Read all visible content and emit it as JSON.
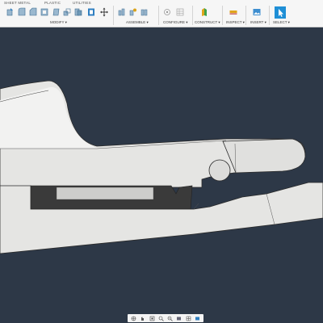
{
  "ribbon": {
    "tabs": [
      {
        "label": "SHEET METAL"
      },
      {
        "label": "PLASTIC"
      },
      {
        "label": "UTILITIES"
      }
    ],
    "groups": [
      {
        "label": "MODIFY ▾"
      },
      {
        "label": "ASSEMBLE ▾"
      },
      {
        "label": "CONFIGURE ▾"
      },
      {
        "label": "CONSTRUCT ▾"
      },
      {
        "label": "INSPECT ▾"
      },
      {
        "label": "INSERT ▾"
      },
      {
        "label": "SELECT ▾"
      }
    ]
  },
  "viewport": {
    "background_color": "#2d3847",
    "part_color": "#e7e7e5",
    "slot_color": "#3a3a3a"
  },
  "navbar": {
    "icons": [
      "orbit-icon",
      "pan-icon",
      "look-at-icon",
      "zoom-icon",
      "fit-icon",
      "display-settings-icon",
      "grid-icon",
      "viewports-icon"
    ]
  }
}
